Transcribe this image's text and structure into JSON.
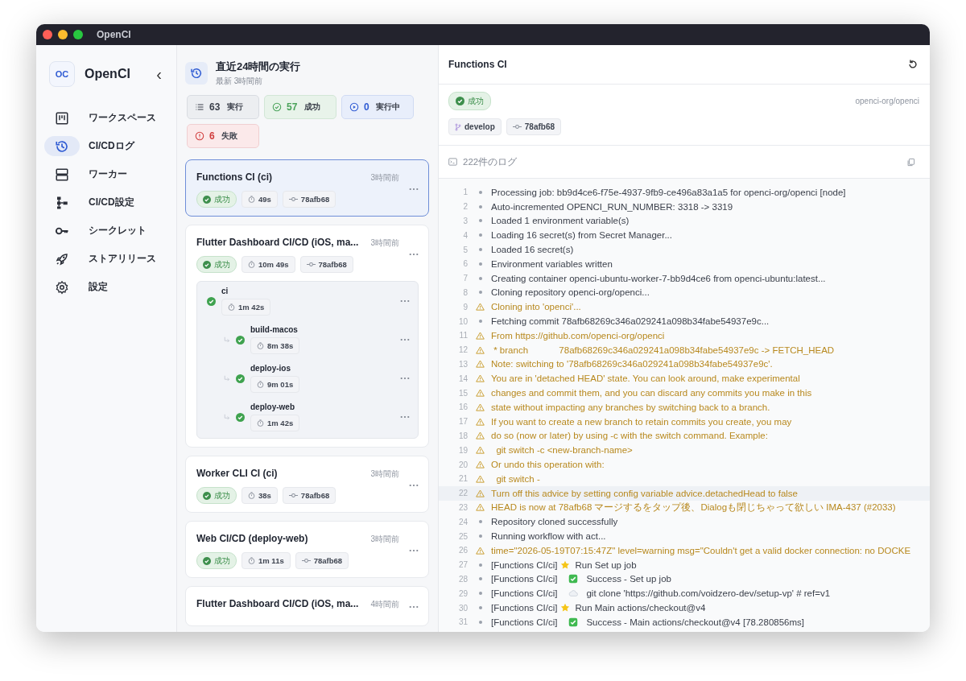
{
  "window": {
    "title": "OpenCI"
  },
  "sidebar": {
    "logo": "OC",
    "app_name": "OpenCI",
    "collapse": "‹",
    "items": [
      {
        "label": "ワークスペース",
        "selected": false
      },
      {
        "label": "CI/CDログ",
        "selected": true
      },
      {
        "label": "ワーカー",
        "selected": false
      },
      {
        "label": "CI/CD設定",
        "selected": false
      },
      {
        "label": "シークレット",
        "selected": false
      },
      {
        "label": "ストアリリース",
        "selected": false
      },
      {
        "label": "設定",
        "selected": false
      }
    ]
  },
  "runs_panel": {
    "title": "直近24時間の実行",
    "subtitle": "最新 3時間前",
    "stats": [
      {
        "kind": "total",
        "count": "63",
        "label": "実行"
      },
      {
        "kind": "success",
        "count": "57",
        "label": "成功"
      },
      {
        "kind": "running",
        "count": "0",
        "label": "実行中"
      },
      {
        "kind": "failed",
        "count": "6",
        "label": "失敗"
      }
    ],
    "runs": [
      {
        "title": "Functions CI (ci)",
        "time": "3時間前",
        "selected": true,
        "succeeded": true,
        "status_label": "成功",
        "duration": "49s",
        "commit": "78afb68"
      },
      {
        "title": "Flutter Dashboard CI/CD (iOS, ma...",
        "time": "3時間前",
        "selected": false,
        "succeeded": true,
        "status_label": "成功",
        "duration": "10m 49s",
        "commit": "78afb68",
        "jobs": [
          {
            "name": "ci",
            "duration": "1m 42s",
            "succeeded": true,
            "children": [
              {
                "name": "build-macos",
                "duration": "8m 38s",
                "succeeded": true
              },
              {
                "name": "deploy-ios",
                "duration": "9m 01s",
                "succeeded": true
              },
              {
                "name": "deploy-web",
                "duration": "1m 42s",
                "succeeded": true
              }
            ]
          }
        ]
      },
      {
        "title": "Worker CLI CI (ci)",
        "time": "3時間前",
        "selected": false,
        "succeeded": true,
        "status_label": "成功",
        "duration": "38s",
        "commit": "78afb68"
      },
      {
        "title": "Web CI/CD (deploy-web)",
        "time": "3時間前",
        "selected": false,
        "succeeded": true,
        "status_label": "成功",
        "duration": "1m 11s",
        "commit": "78afb68"
      },
      {
        "title": "Flutter Dashboard CI/CD (iOS, ma...",
        "time": "4時間前",
        "selected": false
      }
    ]
  },
  "detail": {
    "title": "Functions CI",
    "succeeded": true,
    "status_label": "成功",
    "repo": "openci-org/openci",
    "branch": "develop",
    "commit": "78afb68",
    "log_count": "222件のログ",
    "log": [
      {
        "n": "1",
        "kind": "info",
        "text": "Processing job: bb9d4ce6-f75e-4937-9fb9-ce496a83a1a5 for openci-org/openci [node]"
      },
      {
        "n": "2",
        "kind": "info",
        "text": "Auto-incremented OPENCI_RUN_NUMBER: 3318 -> 3319"
      },
      {
        "n": "3",
        "kind": "info",
        "text": "Loaded 1 environment variable(s)"
      },
      {
        "n": "4",
        "kind": "info",
        "text": "Loading 16 secret(s) from Secret Manager..."
      },
      {
        "n": "5",
        "kind": "info",
        "text": "Loaded 16 secret(s)"
      },
      {
        "n": "6",
        "kind": "info",
        "text": "Environment variables written"
      },
      {
        "n": "7",
        "kind": "info",
        "text": "Creating container openci-ubuntu-worker-7-bb9d4ce6 from openci-ubuntu:latest..."
      },
      {
        "n": "8",
        "kind": "info",
        "text": "Cloning repository openci-org/openci..."
      },
      {
        "n": "9",
        "kind": "warn",
        "text": "Cloning into 'openci'..."
      },
      {
        "n": "10",
        "kind": "info",
        "text": "Fetching commit 78afb68269c346a029241a098b34fabe54937e9c..."
      },
      {
        "n": "11",
        "kind": "warn",
        "text": "From https://github.com/openci-org/openci"
      },
      {
        "n": "12",
        "kind": "warn",
        "text": " * branch            78afb68269c346a029241a098b34fabe54937e9c -> FETCH_HEAD"
      },
      {
        "n": "13",
        "kind": "warn",
        "text": "Note: switching to '78afb68269c346a029241a098b34fabe54937e9c'."
      },
      {
        "n": "14",
        "kind": "warn",
        "text": "You are in 'detached HEAD' state. You can look around, make experimental"
      },
      {
        "n": "15",
        "kind": "warn",
        "text": "changes and commit them, and you can discard any commits you make in this"
      },
      {
        "n": "16",
        "kind": "warn",
        "text": "state without impacting any branches by switching back to a branch."
      },
      {
        "n": "17",
        "kind": "warn",
        "text": "If you want to create a new branch to retain commits you create, you may"
      },
      {
        "n": "18",
        "kind": "warn",
        "text": "do so (now or later) by using -c with the switch command. Example:"
      },
      {
        "n": "19",
        "kind": "warn",
        "text": "  git switch -c <new-branch-name>"
      },
      {
        "n": "20",
        "kind": "warn",
        "text": "Or undo this operation with:"
      },
      {
        "n": "21",
        "kind": "warn",
        "text": "  git switch -"
      },
      {
        "n": "22",
        "kind": "warn",
        "highlighted": true,
        "text": "Turn off this advice by setting config variable advice.detachedHead to false"
      },
      {
        "n": "23",
        "kind": "warn",
        "text": "HEAD is now at 78afb68 マージするをタップ後、Dialogも閉じちゃって欲しい IMA-437 (#2033)"
      },
      {
        "n": "24",
        "kind": "info",
        "text": "Repository cloned successfully"
      },
      {
        "n": "25",
        "kind": "info",
        "text": "Running workflow with act..."
      },
      {
        "n": "26",
        "kind": "warn",
        "text": "time=\"2026-05-19T07:15:47Z\" level=warning msg=\"Couldn't get a valid docker connection: no DOCKE"
      },
      {
        "n": "27",
        "kind": "info",
        "prefix": "[Functions CI/ci]",
        "step": {
          "kind": "star"
        },
        "text": "Run Set up job"
      },
      {
        "n": "28",
        "kind": "info",
        "prefix": "[Functions CI/ci]",
        "step": {
          "kind": "check"
        },
        "text": "Success - Set up job"
      },
      {
        "n": "29",
        "kind": "info",
        "prefix": "[Functions CI/ci]",
        "step": {
          "kind": "cloud"
        },
        "text": "git clone 'https://github.com/voidzero-dev/setup-vp' # ref=v1"
      },
      {
        "n": "30",
        "kind": "info",
        "prefix": "[Functions CI/ci]",
        "step": {
          "kind": "star"
        },
        "text": "Run Main actions/checkout@v4"
      },
      {
        "n": "31",
        "kind": "info",
        "prefix": "[Functions CI/ci]",
        "step": {
          "kind": "check"
        },
        "text": "Success - Main actions/checkout@v4 [78.280856ms]"
      }
    ]
  }
}
